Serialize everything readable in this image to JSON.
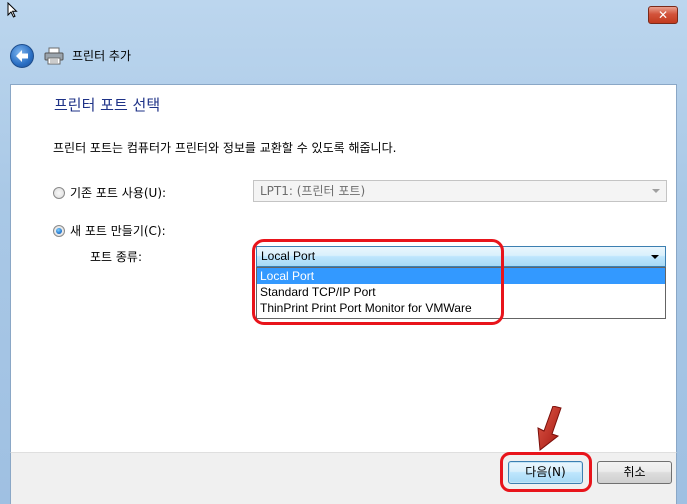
{
  "window": {
    "close_label": "✕"
  },
  "nav": {
    "title": "프린터 추가"
  },
  "page": {
    "heading": "프린터 포트 선택",
    "description": "프린터 포트는 컴퓨터가 프린터와 정보를 교환할 수 있도록 해줍니다."
  },
  "options": {
    "existing_label": "기존 포트 사용(U):",
    "existing_value": "LPT1: (프린터 포트)",
    "existing_checked": false,
    "new_label": "새 포트 만들기(C):",
    "new_checked": true,
    "port_type_label": "포트 종류:",
    "port_type_value": "Local Port",
    "port_type_options": [
      "Local Port",
      "Standard TCP/IP Port",
      "ThinPrint Print Port Monitor for VMWare"
    ]
  },
  "buttons": {
    "next": "다음(N)",
    "cancel": "취소"
  },
  "colors": {
    "heading": "#1e3287",
    "selection": "#3399ff",
    "annotation": "#e8141b"
  }
}
